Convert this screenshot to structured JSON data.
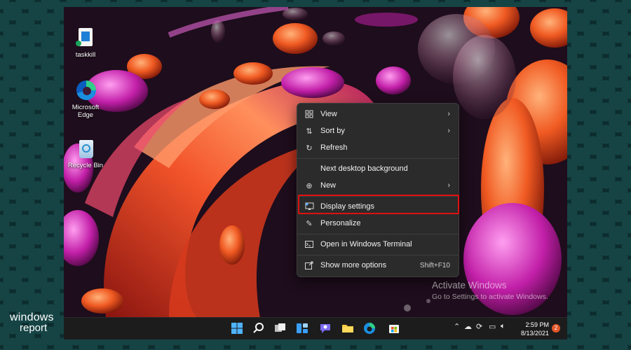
{
  "desktop": {
    "icons": [
      {
        "label": "taskkill"
      },
      {
        "label": "Microsoft Edge"
      },
      {
        "label": "Recycle Bin"
      }
    ]
  },
  "context_menu": {
    "items": [
      {
        "label": "View",
        "icon": "view-grid-icon",
        "submenu": true
      },
      {
        "label": "Sort by",
        "icon": "sort-icon",
        "submenu": true
      },
      {
        "label": "Refresh",
        "icon": "refresh-icon"
      },
      {
        "label": "Next desktop background"
      },
      {
        "label": "New",
        "icon": "plus-circle-icon",
        "submenu": true
      },
      {
        "label": "Display settings",
        "icon": "display-icon",
        "highlighted": true
      },
      {
        "label": "Personalize",
        "icon": "pen-icon"
      },
      {
        "label": "Open in Windows Terminal",
        "icon": "terminal-icon"
      },
      {
        "label": "Show more options",
        "icon": "share-icon",
        "shortcut": "Shift+F10"
      }
    ],
    "highlight_color": "#e01010"
  },
  "watermark": {
    "line1": "Activate Windows",
    "line2": "Go to Settings to activate Windows."
  },
  "taskbar": {
    "apps": [
      "windows-start-icon",
      "search-icon",
      "task-view-icon",
      "widgets-icon",
      "chat-icon",
      "file-explorer-icon",
      "edge-icon",
      "store-icon"
    ],
    "clock_time": "2:59 PM",
    "clock_date": "8/13/2021",
    "notification_count": "2"
  },
  "branding": {
    "line1": "windows",
    "line2": "report"
  }
}
